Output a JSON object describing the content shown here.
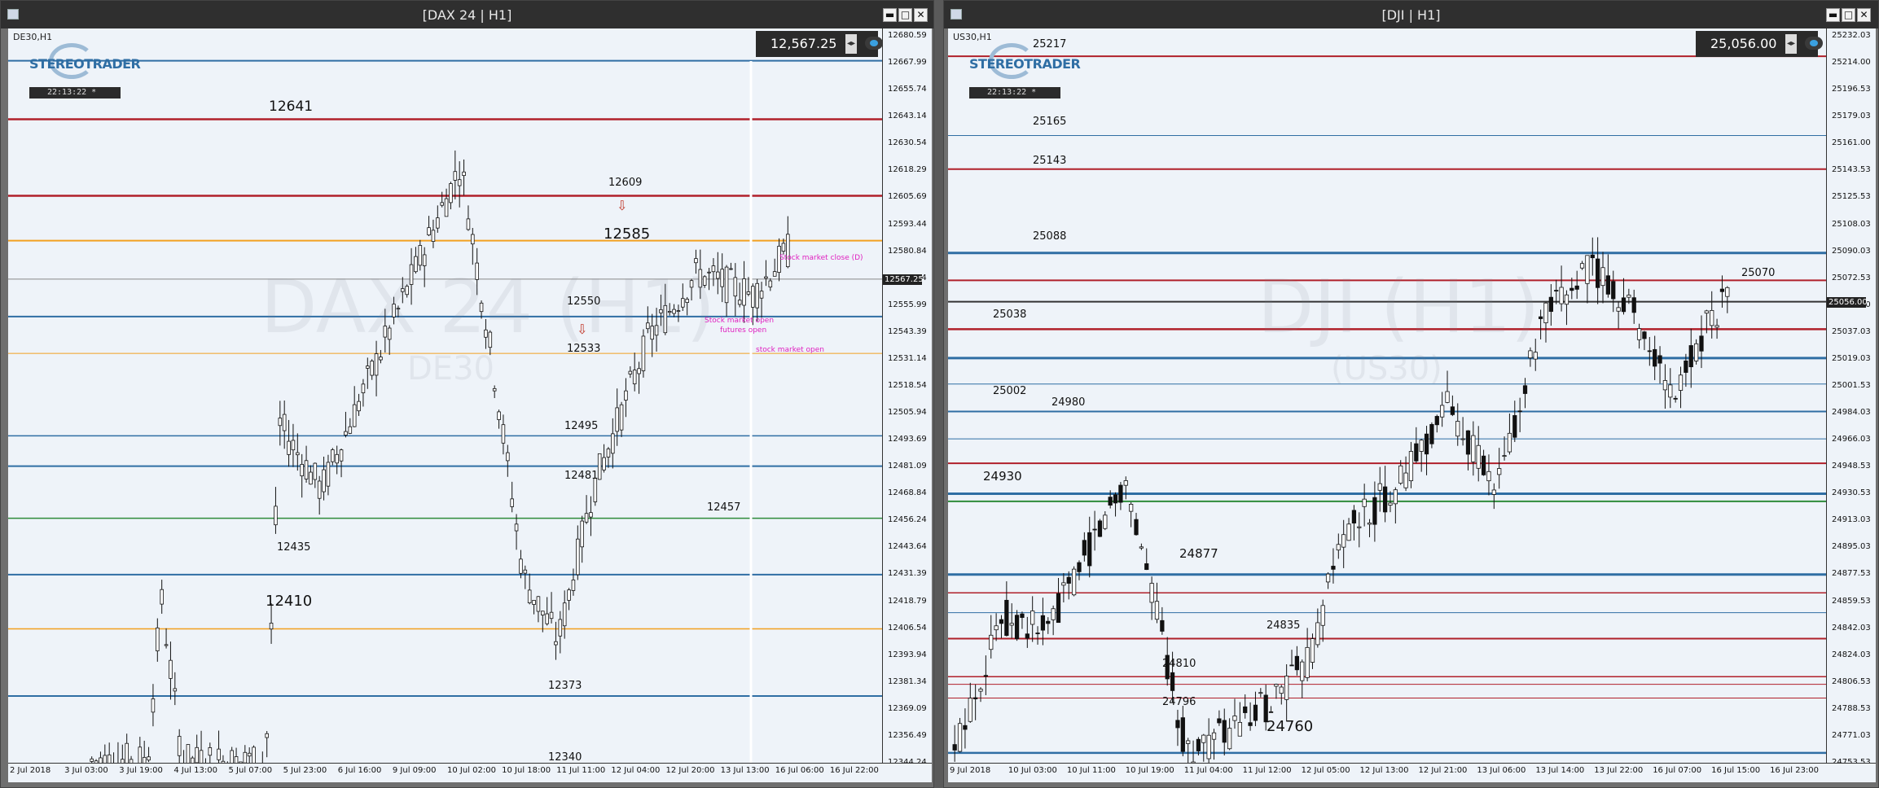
{
  "windows": [
    {
      "title": "[DAX 24 | H1]",
      "symbol_tag": "DE30,H1",
      "logo": "STEREOTRADER",
      "server_time": "22:13:22 *",
      "price_display": "12,567.25",
      "watermark": "DAX 24 (H1)",
      "watermark_sub": "DE30",
      "price_axis": [
        "12680.59",
        "12667.99",
        "12655.74",
        "12643.14",
        "12630.54",
        "12618.29",
        "12605.69",
        "12593.44",
        "12580.84",
        "12568.24",
        "12555.99",
        "12543.39",
        "12531.14",
        "12518.54",
        "12505.94",
        "12493.69",
        "12481.09",
        "12468.84",
        "12456.24",
        "12443.64",
        "12431.39",
        "12418.79",
        "12406.54",
        "12393.94",
        "12381.34",
        "12369.09",
        "12356.49",
        "12344.24"
      ],
      "current_price_tag": "12567.25",
      "time_axis": [
        "2 Jul 2018",
        "3 Jul 03:00",
        "3 Jul 19:00",
        "4 Jul 13:00",
        "5 Jul 07:00",
        "5 Jul 23:00",
        "6 Jul 16:00",
        "9 Jul 09:00",
        "10 Jul 02:00",
        "10 Jul 18:00",
        "11 Jul 11:00",
        "12 Jul 04:00",
        "12 Jul 20:00",
        "13 Jul 13:00",
        "16 Jul 06:00",
        "16 Jul 22:00"
      ],
      "level_labels": [
        "12641",
        "12609",
        "12585",
        "12550",
        "12533",
        "12495",
        "12481",
        "12457",
        "12435",
        "12410",
        "12373",
        "12340"
      ],
      "annotations": [
        "Stock market close (D)",
        "Stock market open",
        "futures open",
        "stock market open"
      ]
    },
    {
      "title": "[DJI | H1]",
      "symbol_tag": "US30,H1",
      "logo": "STEREOTRADER",
      "server_time": "22:13:22 *",
      "price_display": "25,056.00",
      "watermark": "DJI (H1)",
      "watermark_sub": "(US30)",
      "price_axis": [
        "25232.03",
        "25214.00",
        "25196.53",
        "25179.03",
        "25161.00",
        "25143.53",
        "25125.53",
        "25108.03",
        "25090.03",
        "25072.53",
        "25056.00",
        "25037.03",
        "25019.03",
        "25001.53",
        "24984.03",
        "24966.03",
        "24948.53",
        "24930.53",
        "24913.03",
        "24895.03",
        "24877.53",
        "24859.53",
        "24842.03",
        "24824.03",
        "24806.53",
        "24788.53",
        "24771.03",
        "24753.53"
      ],
      "current_price_tag": "25056.00",
      "time_axis": [
        "9 Jul 2018",
        "10 Jul 03:00",
        "10 Jul 11:00",
        "10 Jul 19:00",
        "11 Jul 04:00",
        "11 Jul 12:00",
        "12 Jul 05:00",
        "12 Jul 13:00",
        "12 Jul 21:00",
        "13 Jul 06:00",
        "13 Jul 14:00",
        "13 Jul 22:00",
        "16 Jul 07:00",
        "16 Jul 15:00",
        "16 Jul 23:00"
      ],
      "level_labels": [
        "25217",
        "25165",
        "25143",
        "25088",
        "25070",
        "25038",
        "25002",
        "24980",
        "24930",
        "24877",
        "24835",
        "24810",
        "24796",
        "24760"
      ]
    }
  ],
  "chart_data": [
    {
      "type": "line",
      "title": "[DAX 24 | H1]",
      "xlabel": "",
      "ylabel": "",
      "ylim": [
        12344.24,
        12680.59
      ],
      "grid": false,
      "series": [
        {
          "name": "",
          "values": [
            12667.99,
            12641,
            12609,
            12585,
            12550,
            12533,
            12495,
            12481,
            12457,
            12435,
            12410,
            12373,
            12340
          ]
        }
      ]
    },
    {
      "type": "line",
      "title": "[DJI | H1]",
      "xlabel": "",
      "ylabel": "",
      "ylim": [
        24753.53,
        25232.03
      ],
      "grid": false,
      "series": [
        {
          "name": "",
          "values": [
            25217,
            25165,
            25143,
            25088,
            25070,
            25038,
            25002,
            24980,
            24930,
            24877,
            24835,
            24810,
            24796,
            24760
          ]
        }
      ]
    }
  ],
  "colors": {
    "red_level": "#b0202a",
    "orange_level": "#f2a020",
    "blue_level": "#2f6ea4",
    "green_level": "#2e8b3a",
    "candle": "#111111"
  }
}
